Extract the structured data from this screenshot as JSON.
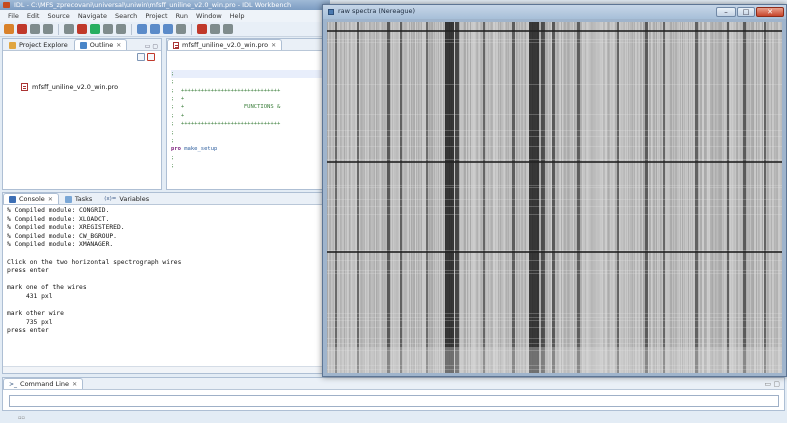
{
  "workbench": {
    "title": "IDL - C:\\MFS_zprecovani\\universal\\uniwin\\mfsff_uniline_v2.0_win.pro - IDL Workbench",
    "menu": [
      "File",
      "Edit",
      "Source",
      "Navigate",
      "Search",
      "Project",
      "Run",
      "Window",
      "Help"
    ],
    "toolbar_icons": [
      {
        "name": "new-file-icon",
        "color": "#d9822b"
      },
      {
        "name": "save-icon",
        "color": "#c0392b"
      },
      {
        "name": "save-all-icon",
        "color": "#7f8c8d"
      },
      {
        "name": "print-icon",
        "color": "#7f8c8d"
      },
      {
        "name": "build-icon",
        "color": "#7f8c8d"
      },
      {
        "name": "debug-icon",
        "color": "#c0392b"
      },
      {
        "name": "run-icon",
        "color": "#27ae60"
      },
      {
        "name": "step-icon",
        "color": "#7f8c8d"
      },
      {
        "name": "resume-icon",
        "color": "#7f8c8d"
      },
      {
        "name": "step-over-icon",
        "color": "#5b8bc9"
      },
      {
        "name": "step-into-icon",
        "color": "#5b8bc9"
      },
      {
        "name": "step-return-icon",
        "color": "#5b8bc9"
      },
      {
        "name": "terminate-icon",
        "color": "#7f8c8d"
      },
      {
        "name": "pin-icon",
        "color": "#c0392b"
      },
      {
        "name": "back-icon",
        "color": "#7f8c8d"
      },
      {
        "name": "forward-icon",
        "color": "#7f8c8d"
      }
    ]
  },
  "project_panel": {
    "tabs": [
      "Project Explore",
      "Outline"
    ],
    "item": "mfsff_uniline_v2.0_win.pro"
  },
  "editor": {
    "tab": "mfsff_uniline_v2.0_win.pro",
    "lines": [
      ";",
      ";",
      ";  ++++++++++++++++++++++++++++++",
      ";  +",
      ";  +                  FUNCTIONS &",
      ";  +",
      ";  ++++++++++++++++++++++++++++++",
      ";",
      ";"
    ],
    "pro_keyword": "pro",
    "pro_name": "make_setup",
    "tail_lines": [
      ";",
      ";"
    ]
  },
  "console": {
    "tabs": [
      "Console",
      "Tasks",
      "Variables"
    ],
    "lines": [
      "% Compiled module: CONGRID.",
      "% Compiled module: XLOADCT.",
      "% Compiled module: XREGISTERED.",
      "% Compiled module: CW_BGROUP.",
      "% Compiled module: XMANAGER.",
      "",
      "Click on the two horizontal spectrograph wires",
      "press enter",
      "",
      "mark one of the wires",
      "     431 pxl",
      "",
      "mark other wire",
      "     735 pxl",
      "press enter"
    ]
  },
  "command_line": {
    "tab": "Command Line",
    "value": ""
  },
  "spectra_window": {
    "title": "raw spectra (Nereague)",
    "buttons": [
      "–",
      "□",
      "✕"
    ]
  }
}
